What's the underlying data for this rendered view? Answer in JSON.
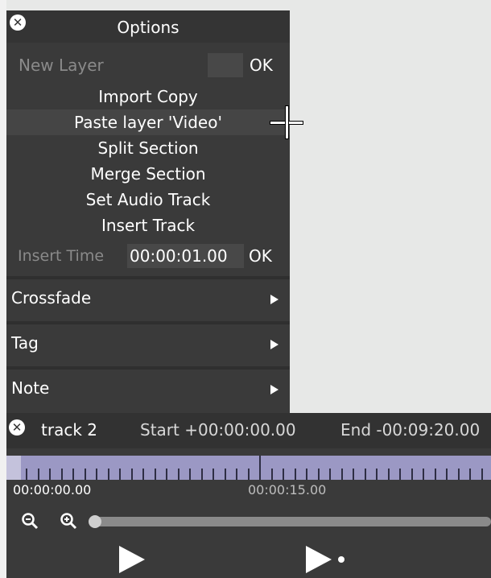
{
  "options": {
    "title": "Options",
    "new_layer": {
      "label": "New Layer",
      "value": "",
      "ok": "OK"
    },
    "items": [
      {
        "label": "Import Copy"
      },
      {
        "label": "Paste layer 'Video'"
      },
      {
        "label": "Split Section"
      },
      {
        "label": "Merge Section"
      },
      {
        "label": "Set Audio Track"
      },
      {
        "label": "Insert Track"
      }
    ],
    "insert_time": {
      "label": "Insert Time",
      "value": "00:00:01.00",
      "ok": "OK"
    },
    "submenus": [
      {
        "label": "Crossfade"
      },
      {
        "label": "Tag"
      },
      {
        "label": "Note"
      }
    ]
  },
  "track": {
    "name": "track 2",
    "start": "Start +00:00:00.00",
    "end": "End -00:09:20.00",
    "timestamps": [
      "00:00:00.00",
      "00:00:15.00"
    ]
  },
  "icons": {
    "close": "close-icon",
    "zoom_out": "zoom-out-icon",
    "zoom_in": "zoom-in-icon",
    "play": "play-icon",
    "play_selection": "play-selection-icon",
    "submenu_arrow": "triangle-right-icon"
  },
  "colors": {
    "timeline": "#9b98c4",
    "panel": "#3a3a3a",
    "background": "#e7e8e7"
  }
}
